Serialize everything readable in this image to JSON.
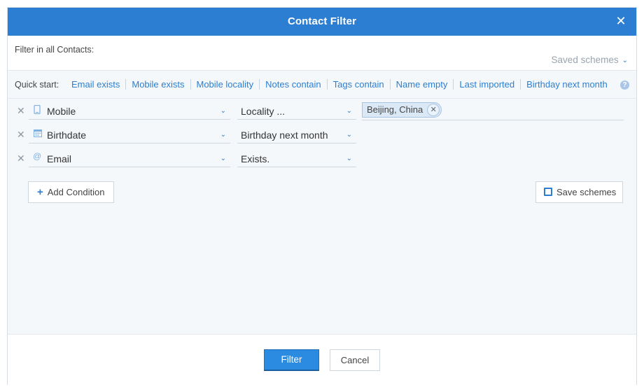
{
  "dialog": {
    "title": "Contact Filter",
    "close_glyph": "✕"
  },
  "scope": {
    "label": "Filter in all Contacts:",
    "saved_schemes": "Saved schemes"
  },
  "quickstart": {
    "label": "Quick start:",
    "links": [
      "Email exists",
      "Mobile exists",
      "Mobile locality",
      "Notes contain",
      "Tags contain",
      "Name empty",
      "Last imported",
      "Birthday next month"
    ],
    "help_glyph": "?"
  },
  "conditions": [
    {
      "field": "Mobile",
      "field_icon": "mobile-phone-icon",
      "operator": "Locality ...",
      "value_tag": "Beijing, China"
    },
    {
      "field": "Birthdate",
      "field_icon": "calendar-icon",
      "operator": "Birthday next month"
    },
    {
      "field": "Email",
      "field_icon": "at-sign-icon",
      "operator": "Exists."
    }
  ],
  "actions": {
    "add_condition": "Add Condition",
    "save_schemes": "Save schemes"
  },
  "footer": {
    "filter": "Filter",
    "cancel": "Cancel"
  },
  "colors": {
    "accent": "#2b7ed1",
    "title_bar": "#2b7ed1",
    "primary_button": "#2b8be0",
    "panel_bg": "#f5f8fb"
  }
}
